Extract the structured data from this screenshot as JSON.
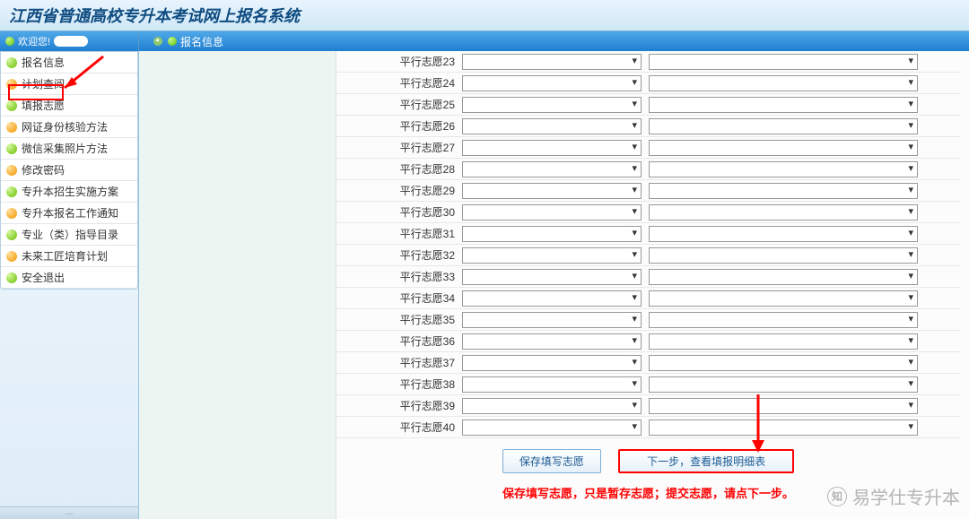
{
  "header": {
    "title": "江西省普通高校专升本考试网上报名系统"
  },
  "topbar": {
    "welcome": "欢迎您!",
    "page_label": "报名信息"
  },
  "sidebar": {
    "items": [
      {
        "label": "报名信息",
        "icon": "green"
      },
      {
        "label": "计划查阅",
        "icon": "orange"
      },
      {
        "label": "填报志愿",
        "icon": "green"
      },
      {
        "label": "网证身份核验方法",
        "icon": "orange"
      },
      {
        "label": "微信采集照片方法",
        "icon": "green"
      },
      {
        "label": "修改密码",
        "icon": "orange"
      },
      {
        "label": "专升本招生实施方案",
        "icon": "green"
      },
      {
        "label": "专升本报名工作通知",
        "icon": "orange"
      },
      {
        "label": "专业（类）指导目录",
        "icon": "green"
      },
      {
        "label": "未来工匠培育计划",
        "icon": "orange"
      },
      {
        "label": "安全退出",
        "icon": "green"
      }
    ]
  },
  "form": {
    "label_prefix": "平行志愿",
    "start": 23,
    "end": 40
  },
  "buttons": {
    "save": "保存填写志愿",
    "next": "下一步，查看填报明细表"
  },
  "footer": "保存填写志愿，只是暂存志愿；提交志愿，请点下一步。",
  "watermark": "易学仕专升本"
}
